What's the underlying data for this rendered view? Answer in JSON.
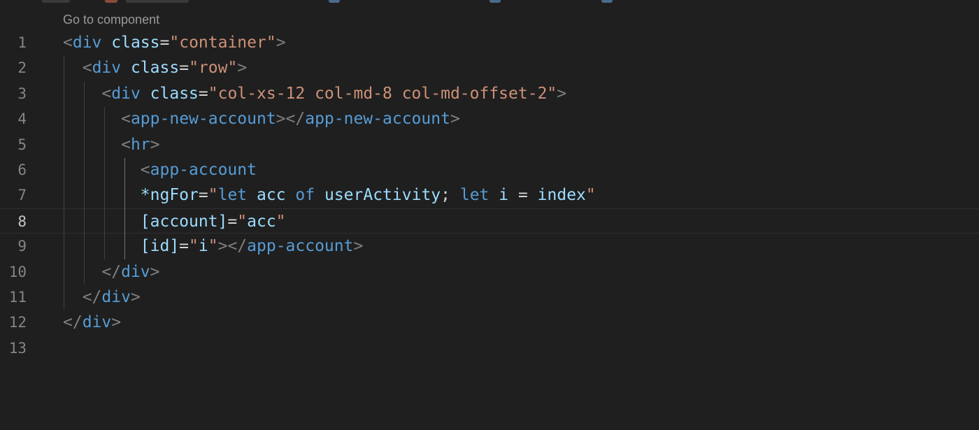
{
  "theme": {
    "background": "#1f1f1f",
    "line_number": "#858585",
    "punctuation": "#808080",
    "tag": "#569cd6",
    "attribute": "#9cdcfe",
    "string": "#ce9178"
  },
  "codelens": "Go to component",
  "current_line": 8,
  "lines": [
    {
      "n": "1",
      "tokens": [
        [
          "t-punc",
          "<"
        ],
        [
          "t-tag",
          "div"
        ],
        [
          "t-eq",
          " "
        ],
        [
          "t-attr",
          "class"
        ],
        [
          "t-eq",
          "="
        ],
        [
          "t-str",
          "\"container\""
        ],
        [
          "t-punc",
          ">"
        ]
      ]
    },
    {
      "n": "2",
      "tokens": [
        [
          "t-eq",
          "  "
        ],
        [
          "t-punc",
          "<"
        ],
        [
          "t-tag",
          "div"
        ],
        [
          "t-eq",
          " "
        ],
        [
          "t-attr",
          "class"
        ],
        [
          "t-eq",
          "="
        ],
        [
          "t-str",
          "\"row\""
        ],
        [
          "t-punc",
          ">"
        ]
      ]
    },
    {
      "n": "3",
      "tokens": [
        [
          "t-eq",
          "    "
        ],
        [
          "t-punc",
          "<"
        ],
        [
          "t-tag",
          "div"
        ],
        [
          "t-eq",
          " "
        ],
        [
          "t-attr",
          "class"
        ],
        [
          "t-eq",
          "="
        ],
        [
          "t-str",
          "\"col-xs-12 col-md-8 col-md-offset-2\""
        ],
        [
          "t-punc",
          ">"
        ]
      ]
    },
    {
      "n": "4",
      "tokens": [
        [
          "t-eq",
          "      "
        ],
        [
          "t-punc",
          "<"
        ],
        [
          "t-tag",
          "app-new-account"
        ],
        [
          "t-punc",
          "></"
        ],
        [
          "t-tag",
          "app-new-account"
        ],
        [
          "t-punc",
          ">"
        ]
      ]
    },
    {
      "n": "5",
      "tokens": [
        [
          "t-eq",
          "      "
        ],
        [
          "t-punc",
          "<"
        ],
        [
          "t-tag",
          "hr"
        ],
        [
          "t-punc",
          ">"
        ]
      ]
    },
    {
      "n": "6",
      "tokens": [
        [
          "t-eq",
          "        "
        ],
        [
          "t-punc",
          "<"
        ],
        [
          "t-tag",
          "app-account"
        ]
      ]
    },
    {
      "n": "7",
      "tokens": [
        [
          "t-eq",
          "        "
        ],
        [
          "t-attr",
          "*ngFor"
        ],
        [
          "t-eq",
          "="
        ],
        [
          "t-str",
          "\""
        ],
        [
          "t-kw",
          "let"
        ],
        [
          "t-eq",
          " "
        ],
        [
          "t-var",
          "acc"
        ],
        [
          "t-eq",
          " "
        ],
        [
          "t-kw",
          "of"
        ],
        [
          "t-eq",
          " "
        ],
        [
          "t-var",
          "userActivity"
        ],
        [
          "t-eq",
          "; "
        ],
        [
          "t-kw",
          "let"
        ],
        [
          "t-eq",
          " "
        ],
        [
          "t-var",
          "i"
        ],
        [
          "t-eq",
          " = "
        ],
        [
          "t-var",
          "index"
        ],
        [
          "t-str",
          "\""
        ]
      ]
    },
    {
      "n": "8",
      "tokens": [
        [
          "t-eq",
          "        "
        ],
        [
          "t-attr",
          "[account]"
        ],
        [
          "t-eq",
          "="
        ],
        [
          "t-str",
          "\""
        ],
        [
          "t-var",
          "acc"
        ],
        [
          "t-str",
          "\""
        ]
      ]
    },
    {
      "n": "9",
      "tokens": [
        [
          "t-eq",
          "        "
        ],
        [
          "t-attr",
          "[id]"
        ],
        [
          "t-eq",
          "="
        ],
        [
          "t-str",
          "\""
        ],
        [
          "t-var",
          "i"
        ],
        [
          "t-str",
          "\""
        ],
        [
          "t-punc",
          "></"
        ],
        [
          "t-tag",
          "app-account"
        ],
        [
          "t-punc",
          ">"
        ]
      ]
    },
    {
      "n": "10",
      "tokens": [
        [
          "t-eq",
          "    "
        ],
        [
          "t-punc",
          "</"
        ],
        [
          "t-tag",
          "div"
        ],
        [
          "t-punc",
          ">"
        ]
      ]
    },
    {
      "n": "11",
      "tokens": [
        [
          "t-eq",
          "  "
        ],
        [
          "t-punc",
          "</"
        ],
        [
          "t-tag",
          "div"
        ],
        [
          "t-punc",
          ">"
        ]
      ]
    },
    {
      "n": "12",
      "tokens": [
        [
          "t-punc",
          "</"
        ],
        [
          "t-tag",
          "div"
        ],
        [
          "t-punc",
          ">"
        ]
      ]
    },
    {
      "n": "13",
      "tokens": []
    }
  ]
}
